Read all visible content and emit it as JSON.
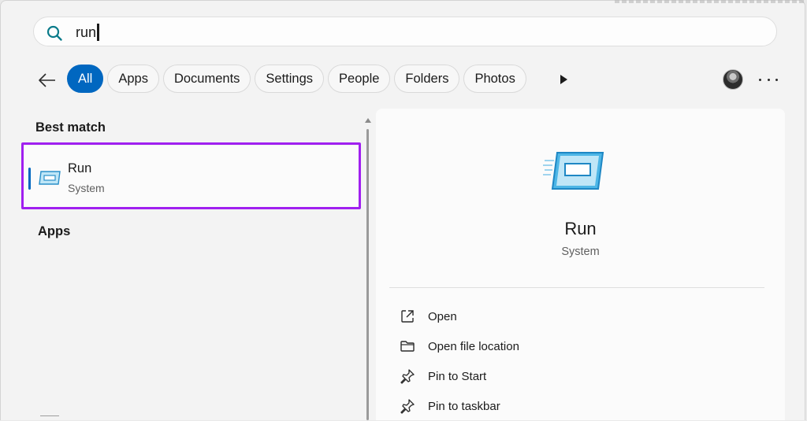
{
  "search": {
    "query": "run"
  },
  "filters": [
    "All",
    "Apps",
    "Documents",
    "Settings",
    "People",
    "Folders",
    "Photos"
  ],
  "left": {
    "best_match_heading": "Best match",
    "best_match": {
      "name": "Run",
      "type": "System"
    },
    "apps_heading": "Apps"
  },
  "detail": {
    "name": "Run",
    "type": "System",
    "actions": [
      "Open",
      "Open file location",
      "Pin to Start",
      "Pin to taskbar"
    ]
  },
  "colors": {
    "accent": "#0067c0",
    "highlight": "#a020f0"
  }
}
